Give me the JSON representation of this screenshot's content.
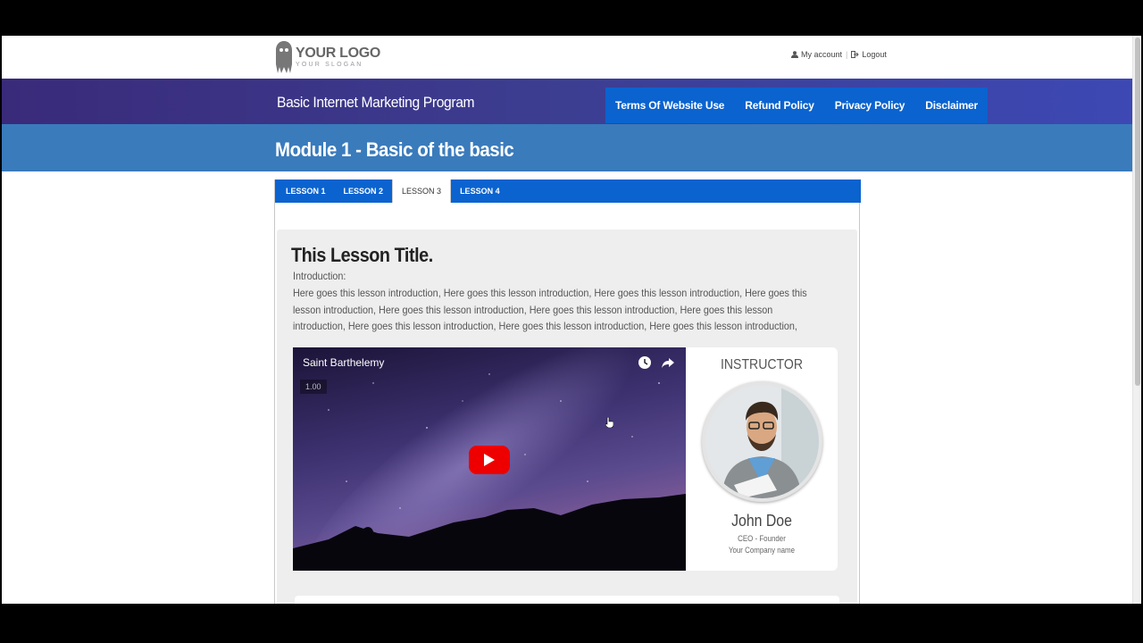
{
  "header": {
    "logo_title": "YOUR LOGO",
    "logo_slogan": "YOUR SLOGAN",
    "my_account_label": "My account",
    "logout_label": "Logout"
  },
  "navbar": {
    "site_title": "Basic Internet Marketing Program",
    "menu": [
      {
        "label": "Terms Of Website Use"
      },
      {
        "label": "Refund Policy"
      },
      {
        "label": "Privacy Policy"
      },
      {
        "label": "Disclaimer"
      }
    ]
  },
  "module": {
    "title": "Module 1 - Basic of the basic"
  },
  "tabs": [
    {
      "label": "LESSON 1",
      "active": false
    },
    {
      "label": "LESSON 2",
      "active": false
    },
    {
      "label": "LESSON 3",
      "active": true
    },
    {
      "label": "LESSON 4",
      "active": false
    }
  ],
  "lesson": {
    "title": "This Lesson Title.",
    "intro_label": "Introduction:",
    "intro_text": "Here goes this lesson introduction, Here goes this lesson introduction, Here goes this lesson introduction, Here goes this lesson introduction, Here goes this lesson introduction, Here goes this lesson introduction, Here goes this lesson introduction, Here goes this lesson introduction, Here goes this lesson introduction, Here goes this lesson introduction,"
  },
  "video": {
    "title": "Saint Barthelemy",
    "speed": "1.00",
    "icons": [
      "watch-later-icon",
      "share-icon"
    ]
  },
  "instructor": {
    "heading": "INSTRUCTOR",
    "name": "John Doe",
    "role": "CEO - Founder",
    "company": "Your Company name"
  },
  "colors": {
    "nav_menu_bg": "#0b63cf",
    "module_bar_bg": "#3a7bbc",
    "navbar_gradient_start": "#3a2a7a",
    "youtube_red": "#ee0000"
  }
}
